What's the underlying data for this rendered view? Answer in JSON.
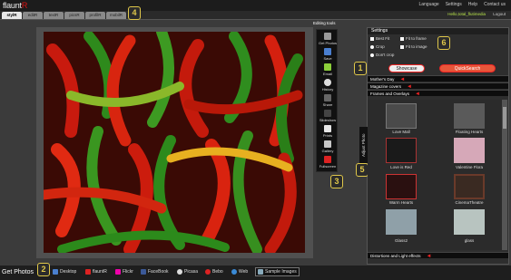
{
  "app": {
    "logo_text": "flaunt",
    "logo_accent": "R"
  },
  "top_menu": [
    "Language",
    "Settings",
    "Help",
    "Contact us"
  ],
  "tabs": [
    "stylR",
    "editR",
    "textR",
    "picsR",
    "profilR",
    "mobilR"
  ],
  "user": {
    "hello": "Hello,total_flutimedia",
    "logout": "Logout"
  },
  "edit_title": "Editing tools",
  "badges": [
    "1",
    "2",
    "3",
    "4",
    "5",
    "6"
  ],
  "tools": [
    "Get Photos",
    "Save",
    "Email",
    "History",
    "Share",
    "Slideshow",
    "Prints",
    "Gallery",
    "Fullscreen"
  ],
  "settings": {
    "title": "Settings",
    "options": [
      "Best Fit",
      "Fit to frame",
      "Crop",
      "Fit to image",
      "Don't crop"
    ]
  },
  "buttons": {
    "showcase": "Showcase",
    "quicksearch": "QuickSearch"
  },
  "categories": [
    "Mother's Day",
    "Magazine covers",
    "Frames and Overlays"
  ],
  "adjust_label": "Adjust Photo",
  "thumbs": [
    "Love Mall",
    "Floating Hearts",
    "Love is Red",
    "Valentine Flora",
    "Warm Hearts",
    "CinemaTheatre",
    "Glass2",
    "glass"
  ],
  "bottom_category": "Distortions and Light effects",
  "get_photos": "Get Photos",
  "sources": [
    "Desktop",
    "flauntR",
    "Flickr",
    "FaceBook",
    "Picasa",
    "Bebo",
    "Web",
    "Sample Images"
  ],
  "colors": {
    "accent_red": "#e02020",
    "highlight_yellow": "#e0c84a",
    "hello_green": "#b5e04a"
  }
}
